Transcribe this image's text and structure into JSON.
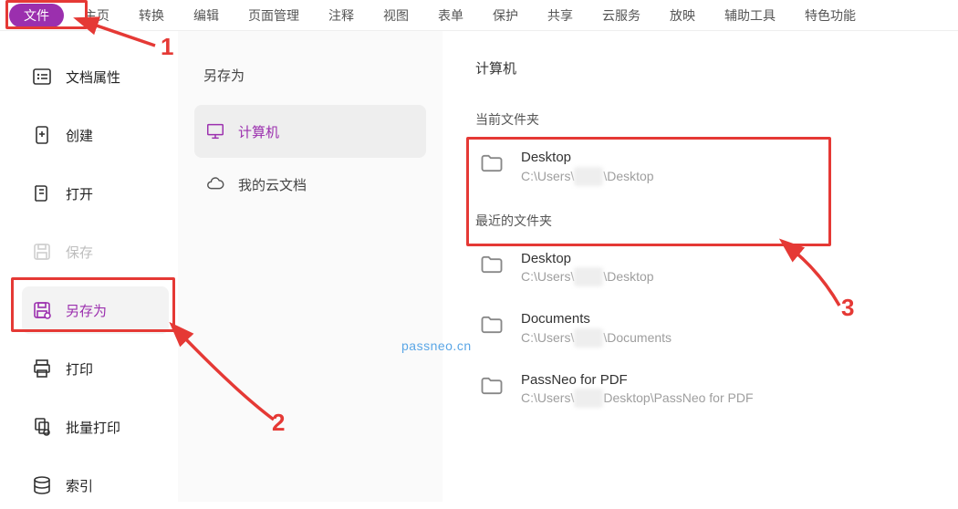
{
  "menu": {
    "tabs": [
      "文件",
      "主页",
      "转换",
      "编辑",
      "页面管理",
      "注释",
      "视图",
      "表单",
      "保护",
      "共享",
      "云服务",
      "放映",
      "辅助工具",
      "特色功能"
    ]
  },
  "sidebar": {
    "items": [
      {
        "id": "props",
        "label": "文档属性"
      },
      {
        "id": "create",
        "label": "创建"
      },
      {
        "id": "open",
        "label": "打开"
      },
      {
        "id": "save",
        "label": "保存"
      },
      {
        "id": "saveas",
        "label": "另存为"
      },
      {
        "id": "print",
        "label": "打印"
      },
      {
        "id": "batchprint",
        "label": "批量打印"
      },
      {
        "id": "index",
        "label": "索引"
      }
    ]
  },
  "middle": {
    "title": "另存为",
    "locations": [
      {
        "id": "computer",
        "label": "计算机"
      },
      {
        "id": "cloud",
        "label": "我的云文档"
      }
    ]
  },
  "right": {
    "title": "计算机",
    "current_label": "当前文件夹",
    "recent_label": "最近的文件夹",
    "current": {
      "name": "Desktop",
      "path_prefix": "C:\\Users\\",
      "path_mid_hidden": "xxxx",
      "path_suffix": "\\Desktop"
    },
    "recent": [
      {
        "name": "Desktop",
        "path_prefix": "C:\\Users\\",
        "path_mid_hidden": "xxxx",
        "path_suffix": "\\Desktop"
      },
      {
        "name": "Documents",
        "path_prefix": "C:\\Users\\",
        "path_mid_hidden": "xxxx",
        "path_suffix": "\\Documents"
      },
      {
        "name": "PassNeo for PDF",
        "path_prefix": "C:\\Users\\",
        "path_mid_hidden": "xxxx",
        "path_suffix": "Desktop\\PassNeo for PDF"
      }
    ]
  },
  "watermark": "passneo.cn",
  "annotations": {
    "n1": "1",
    "n2": "2",
    "n3": "3"
  }
}
